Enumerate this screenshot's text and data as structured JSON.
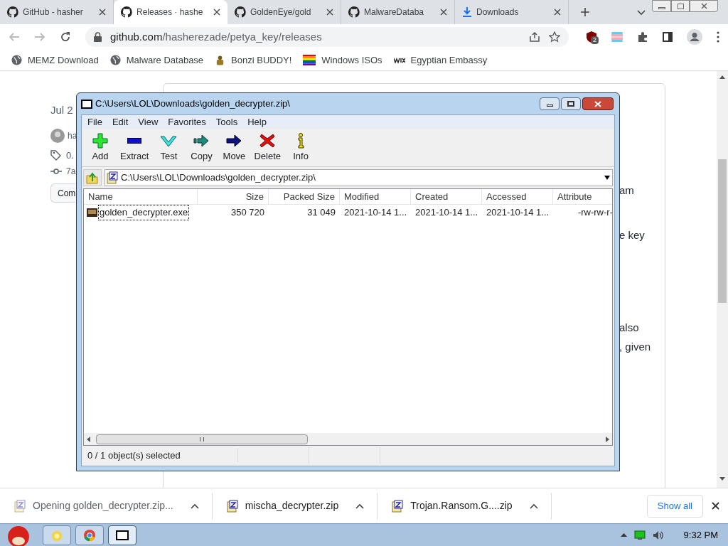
{
  "browser": {
    "tabs": [
      {
        "title": "GitHub - hasher",
        "selected": false
      },
      {
        "title": "Releases · hashe",
        "selected": true
      },
      {
        "title": "GoldenEye/gold",
        "selected": false
      },
      {
        "title": "MalwareDataba",
        "selected": false
      },
      {
        "title": "Downloads",
        "selected": false
      }
    ],
    "address": {
      "host": "github.com",
      "path": "/hasherezade/petya_key/releases"
    },
    "extension_badge": "2",
    "bookmarks": [
      {
        "label": "MEMZ Download"
      },
      {
        "label": "Malware Database"
      },
      {
        "label": "Bonzi BUDDY!"
      },
      {
        "label": "Windows ISOs"
      },
      {
        "label": "Egyptian Embassy"
      }
    ]
  },
  "page": {
    "date": "Jul 2",
    "author": "ha",
    "tag": "0.",
    "commit": "7a",
    "compare_button": "Com",
    "text_fragments": [
      "am",
      "e key",
      "also",
      ", given"
    ]
  },
  "archive_window": {
    "title": "C:\\Users\\LOL\\Downloads\\golden_decrypter.zip\\",
    "menu": [
      "File",
      "Edit",
      "View",
      "Favorites",
      "Tools",
      "Help"
    ],
    "toolbar": [
      {
        "label": "Add",
        "kind": "add"
      },
      {
        "label": "Extract",
        "kind": "extract"
      },
      {
        "label": "Test",
        "kind": "test"
      },
      {
        "label": "Copy",
        "kind": "copy"
      },
      {
        "label": "Move",
        "kind": "move"
      },
      {
        "label": "Delete",
        "kind": "delete"
      },
      {
        "label": "Info",
        "kind": "info"
      }
    ],
    "path": "C:\\Users\\LOL\\Downloads\\golden_decrypter.zip\\",
    "columns": [
      "Name",
      "Size",
      "Packed Size",
      "Modified",
      "Created",
      "Accessed",
      "Attribute"
    ],
    "rows": [
      {
        "cells": [
          "golden_decrypter.exe",
          "350 720",
          "31 049",
          "2021-10-14 1...",
          "2021-10-14 1...",
          "2021-10-14 1...",
          "-rw-rw-r-"
        ],
        "focused": true
      }
    ],
    "status": "0 / 1 object(s) selected"
  },
  "downloads": {
    "items": [
      {
        "name": "Opening golden_decrypter.zip...",
        "in_progress": true
      },
      {
        "name": "mischa_decrypter.zip",
        "in_progress": false
      },
      {
        "name": "Trojan.Ransom.G....zip",
        "in_progress": false
      }
    ],
    "show_all": "Show all"
  },
  "taskbar": {
    "time": "9:32 PM"
  }
}
